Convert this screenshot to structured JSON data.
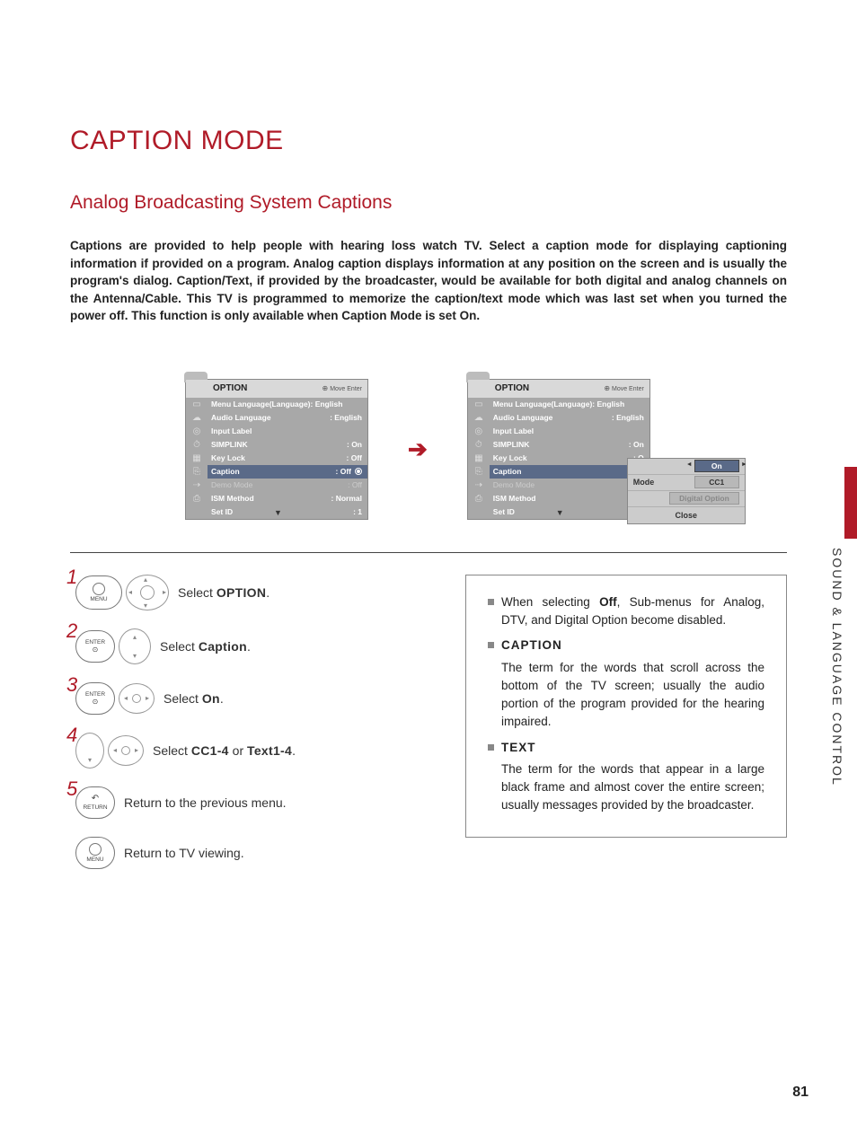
{
  "title": "CAPTION MODE",
  "subtitle": "Analog Broadcasting System Captions",
  "intro_pre": "Captions are provided to help people with hearing loss watch TV. Select a caption mode for displaying captioning information if provided on a program. Analog caption displays information at any position on the screen and is usually the program's dialog. Caption/Text, if provided by the broadcaster, would be available for both digital and analog channels on the Antenna/Cable. This TV is programmed to memorize the caption/text mode which was last set when you turned the power off. This function is only available when ",
  "intro_b1": "Caption",
  "intro_mid": " Mode is set ",
  "intro_b2": "On",
  "intro_end": ".",
  "osd": {
    "header": "OPTION",
    "hint": "Move    Enter",
    "rows": [
      {
        "label": "Menu Language(Language): English",
        "value": ""
      },
      {
        "label": "Audio Language",
        "value": ": English"
      },
      {
        "label": "Input Label",
        "value": ""
      },
      {
        "label": "SIMPLINK",
        "value": ": On"
      },
      {
        "label": "Key Lock",
        "value": ": Off"
      },
      {
        "label": "Caption",
        "value": ": Off"
      },
      {
        "label": "Demo Mode",
        "value": ": Off"
      },
      {
        "label": "ISM Method",
        "value": ": Normal"
      },
      {
        "label": "Set ID",
        "value": ": 1"
      }
    ]
  },
  "popup": {
    "rows": [
      {
        "label": "",
        "value": "On",
        "sel": true
      },
      {
        "label": "Mode",
        "value": "CC1"
      },
      {
        "label": "",
        "value": "Digital Option",
        "disabled": true
      }
    ],
    "close": "Close"
  },
  "steps": [
    {
      "n": "1",
      "btn": "MENU",
      "text_pre": "Select ",
      "text_b": "OPTION",
      "text_post": "."
    },
    {
      "n": "2",
      "btn": "ENTER",
      "text_pre": "Select ",
      "text_b": "Caption",
      "text_post": "."
    },
    {
      "n": "3",
      "btn": "ENTER",
      "text_pre": "Select ",
      "text_b": "On",
      "text_post": "."
    },
    {
      "n": "4",
      "btn": "",
      "text_pre": "Select ",
      "text_b": "CC1-4",
      "text_mid": " or ",
      "text_b2": "Text1-4",
      "text_post": "."
    },
    {
      "n": "5",
      "btn": "RETURN",
      "text_pre": "Return to the previous menu.",
      "text_b": "",
      "text_post": ""
    },
    {
      "n": "",
      "btn": "MENU",
      "text_pre": "Return to TV viewing.",
      "text_b": "",
      "text_post": ""
    }
  ],
  "info": {
    "b1_pre": "When selecting ",
    "b1_b": "Off",
    "b1_post": ", Sub-menus for Analog, DTV, and Digital Option become disabled.",
    "b2_h": "CAPTION",
    "b2_t": "The term for the words that scroll across the bottom of the TV screen; usually the audio portion of the program provided for the hearing impaired.",
    "b3_h": "TEXT",
    "b3_t": "The term for the words that appear in a large black frame and almost cover the entire screen; usually messages provided by the broadcaster."
  },
  "side": "SOUND & LANGUAGE CONTROL",
  "pagenum": "81"
}
